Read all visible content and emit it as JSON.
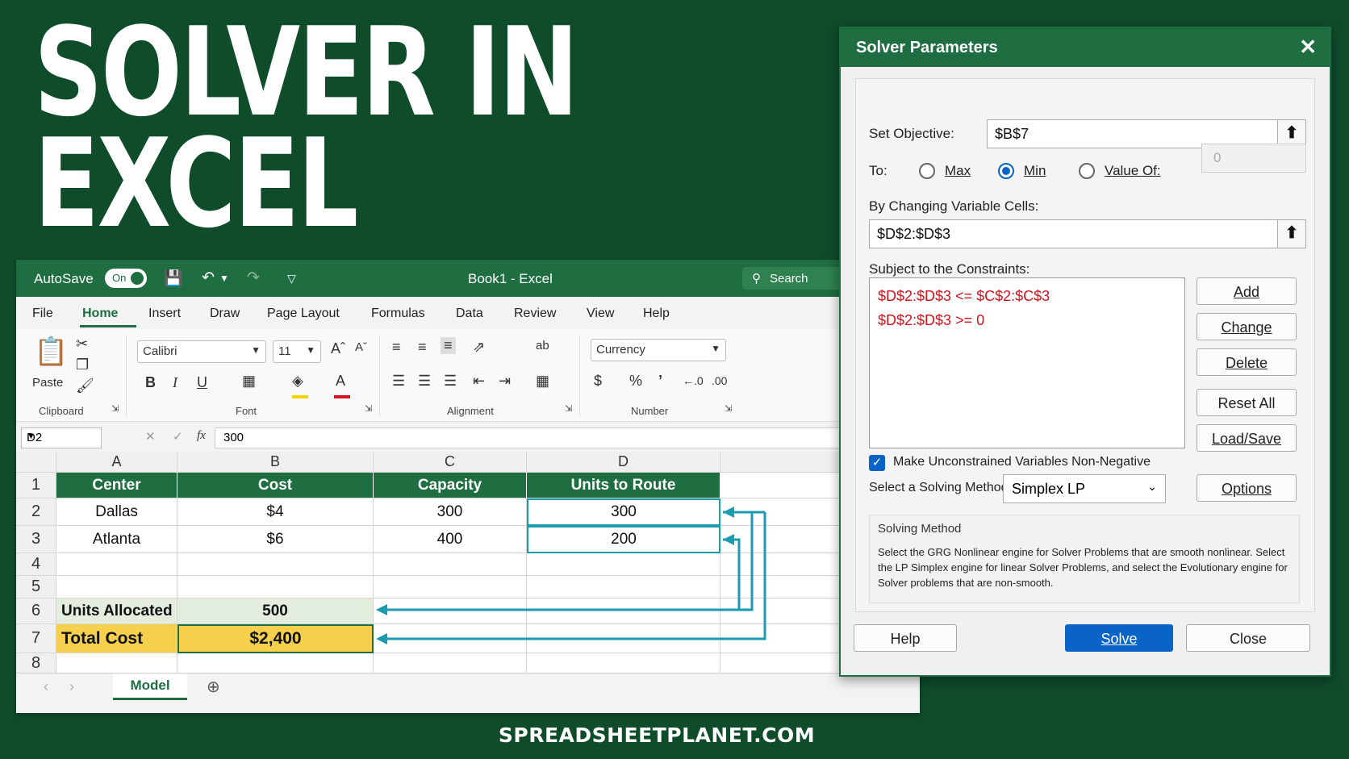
{
  "hero": {
    "line1": "SOLVER IN",
    "line2": "EXCEL"
  },
  "footer": "SPREADSHEETPLANET.COM",
  "excel": {
    "autosave_label": "AutoSave",
    "toggle_label": "On",
    "title": "Book1  -  Excel",
    "search_placeholder": "Search",
    "menu": [
      "File",
      "Home",
      "Insert",
      "Draw",
      "Page Layout",
      "Formulas",
      "Data",
      "Review",
      "View",
      "Help"
    ],
    "ribbon": {
      "paste_label": "Paste",
      "clipboard_label": "Clipboard",
      "font_name": "Calibri",
      "font_size": "11",
      "font_label": "Font",
      "alignment_label": "Alignment",
      "number_format": "Currency",
      "number_label": "Number"
    },
    "namebox": "D2",
    "formula": "300",
    "columns": [
      "A",
      "B",
      "C",
      "D"
    ],
    "rows": [
      "1",
      "2",
      "3",
      "4",
      "5",
      "6",
      "7",
      "8"
    ],
    "table": {
      "headers": [
        "Center",
        "Cost",
        "Capacity",
        "Units to Route"
      ],
      "data": [
        [
          "Dallas",
          "$4",
          "300",
          "300"
        ],
        [
          "Atlanta",
          "$6",
          "400",
          "200"
        ]
      ]
    },
    "alloc_label": "Units Allocated",
    "alloc_value": "500",
    "total_label": "Total Cost",
    "total_value": "$2,400",
    "sheet_tab": "Model",
    "colors": {
      "brand": "#1e6e41",
      "highlight": "#f6d04d",
      "arrow": "#1a9bb0"
    }
  },
  "solver": {
    "title": "Solver Parameters",
    "set_objective_label": "Set Objective:",
    "objective_value": "$B$7",
    "to_label": "To:",
    "max_label": "Max",
    "min_label": "Min",
    "valueof_label": "Value Of:",
    "valueof_value": "0",
    "selected_goal": "Min",
    "changing_label": "By Changing Variable Cells:",
    "changing_value": "$D$2:$D$3",
    "constraints_label": "Subject to the Constraints:",
    "constraints": [
      "$D$2:$D$3 <= $C$2:$C$3",
      "$D$2:$D$3 >= 0"
    ],
    "add_label": "Add",
    "change_label": "Change",
    "delete_label": "Delete",
    "resetall_label": "Reset All",
    "loadsave_label": "Load/Save",
    "nonneg_label": "Make Unconstrained Variables Non-Negative",
    "nonneg_checked": true,
    "method_label": "Select a Solving Method:",
    "method_value": "Simplex LP",
    "options_label": "Options",
    "method_box_title": "Solving Method",
    "method_box_text": "Select the GRG Nonlinear engine for Solver Problems that are smooth nonlinear. Select the LP Simplex engine for linear Solver Problems, and select the Evolutionary engine for Solver problems that are non-smooth.",
    "help_label": "Help",
    "solve_label": "Solve",
    "close_label": "Close"
  }
}
